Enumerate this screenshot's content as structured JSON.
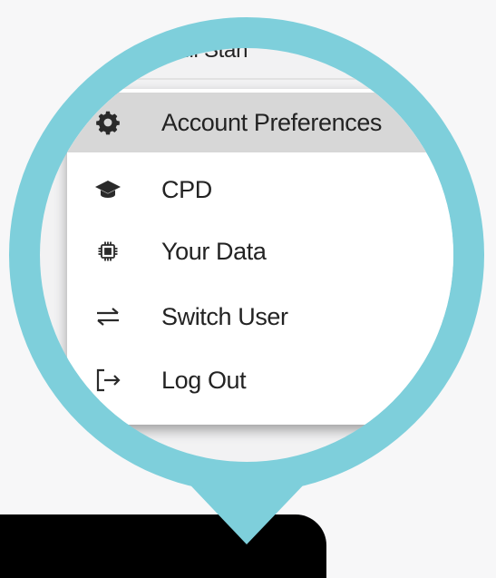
{
  "header": {
    "user_name_partial": "ya Full Stan"
  },
  "menu": {
    "items": [
      {
        "label": "Account Preferences",
        "icon": "gear-icon",
        "highlighted": true
      },
      {
        "label": "CPD",
        "icon": "graduation-cap-icon",
        "highlighted": false
      },
      {
        "label": "Your Data",
        "icon": "chip-icon",
        "highlighted": false
      },
      {
        "label": "Switch User",
        "icon": "switch-arrows-icon",
        "highlighted": false
      },
      {
        "label": "Log Out",
        "icon": "logout-icon",
        "highlighted": false
      }
    ]
  },
  "colors": {
    "pin": "#7ecfdb",
    "highlight": "#d7d7d7",
    "icon": "#2a2a2a",
    "bar": "#000000"
  }
}
